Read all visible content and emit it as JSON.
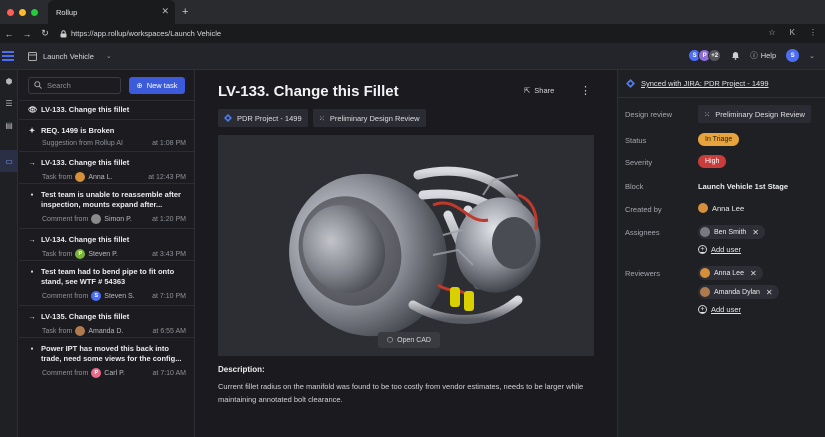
{
  "browser": {
    "tab_title": "Rollup",
    "url": "https://app.rollup/workspaces/Launch Vehicle"
  },
  "app": {
    "workspace": "Launch Vehicle",
    "avatars": [
      "S",
      "P",
      "+2"
    ],
    "help_label": "Help",
    "user_initial": "S"
  },
  "tasks": {
    "search_placeholder": "Search",
    "new_task_label": "New task",
    "items": [
      {
        "icon": "eye-icon",
        "title": "LV-133. Change this fillet",
        "meta_prefix": "",
        "who": "",
        "time": ""
      },
      {
        "icon": "sparkle-icon",
        "title": "REQ. 1499 is Broken",
        "meta_prefix": "Suggestion from Rollup AI",
        "who": "",
        "time": "at 1:08 PM"
      },
      {
        "icon": "arrow-icon",
        "title": "LV-133. Change this fillet",
        "meta_prefix": "Task from",
        "who": "Anna L.",
        "time": "at 12:43 PM"
      },
      {
        "icon": "comment-icon",
        "title": "Test team is unable to reassemble after inspection, mounts expand after...",
        "meta_prefix": "Comment from",
        "who": "Simon P.",
        "time": "at 1:20 PM"
      },
      {
        "icon": "arrow-icon",
        "title": "LV-134. Change this fillet",
        "meta_prefix": "Task from",
        "who": "Steven P.",
        "time": "at 3:43 PM"
      },
      {
        "icon": "comment-icon",
        "title": "Test team had to bend pipe to fit onto stand, see WTF # 54363",
        "meta_prefix": "Comment from",
        "who": "Steven S.",
        "time": "at 7:10 PM"
      },
      {
        "icon": "arrow-icon",
        "title": "LV-135. Change this fillet",
        "meta_prefix": "Task from",
        "who": "Amanda D.",
        "time": "at 6:55 AM"
      },
      {
        "icon": "comment-icon",
        "title": "Power IPT has moved this back into trade, need some views for the config...",
        "meta_prefix": "Comment from",
        "who": "Carl P.",
        "time": "at 7:10 AM"
      }
    ]
  },
  "main": {
    "title": "LV-133. Change this Fillet",
    "share_label": "Share",
    "chips": [
      "PDR Project - 1499",
      "Preliminary Design Review"
    ],
    "open_cad_label": "Open CAD",
    "description_heading": "Description:",
    "description": "Current fillet radius on the manifold was found to be too costly from vendor estimates, needs to be larger while maintaining annotated bolt clearance."
  },
  "details": {
    "sync_label": "Synced with JIRA: PDR Project - 1499",
    "design_review_label": "Design review",
    "design_review_value": "Preliminary Design Review",
    "status_label": "Status",
    "status_value": "In Triage",
    "severity_label": "Severity",
    "severity_value": "High",
    "block_label": "Block",
    "block_value": "Launch Vehicle 1st Stage",
    "created_by_label": "Created by",
    "created_by_value": "Anna Lee",
    "assignees_label": "Assignees",
    "assignee": "Ben Smith",
    "add_user_label": "Add user",
    "reviewers_label": "Reviewers",
    "reviewers": [
      "Anna Lee",
      "Amanda Dylan"
    ],
    "add_user_label_2": "Add user"
  },
  "colors": {
    "accent": "#3b5bdb",
    "status_bg": "#e8a33d",
    "severity_bg": "#c93c3c"
  }
}
